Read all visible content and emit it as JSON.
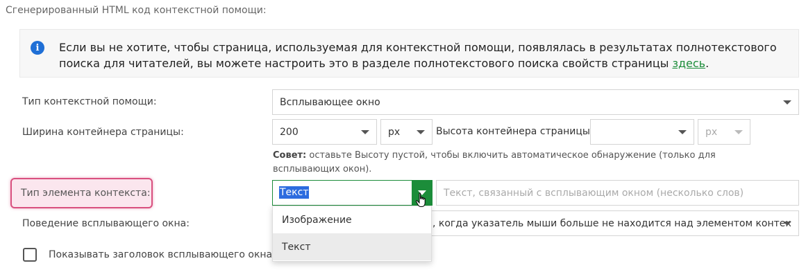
{
  "section_title": "Сгенерированный HTML код контекстной помощи:",
  "info": {
    "text_before": "Если вы не хотите, чтобы страница, используемая для контекстной помощи, появлялась в результатах полнотекстового поиска для читателей, вы можете настроить это в разделе полнотекстового поиска свойств страницы ",
    "link": "здесь",
    "text_after": "."
  },
  "help_type": {
    "label": "Тип контекстной помощи:",
    "value": "Всплывающее окно"
  },
  "container": {
    "width_label": "Ширина контейнера страницы:",
    "width_value": "200",
    "width_unit": "px",
    "height_label": "Высота контейнера страницы:",
    "height_value": "",
    "height_unit": "px"
  },
  "hint": {
    "bold": "Совет:",
    "text": " оставьте Высоту пустой, чтобы включить автоматическое обнаружение (только для всплывающих окон)."
  },
  "element_type": {
    "label": "Тип элемента контекста:",
    "value": "Текст",
    "text_placeholder": "Текст, связанный с всплывающим окном (несколько слов)",
    "options": [
      "Изображение",
      "Текст"
    ]
  },
  "popup_behavior": {
    "label": "Поведение всплывающего окна:",
    "value": ", когда указатель мыши больше не находится над элементом контек"
  },
  "show_title": {
    "label": "Показывать заголовок всплывающего окна"
  }
}
